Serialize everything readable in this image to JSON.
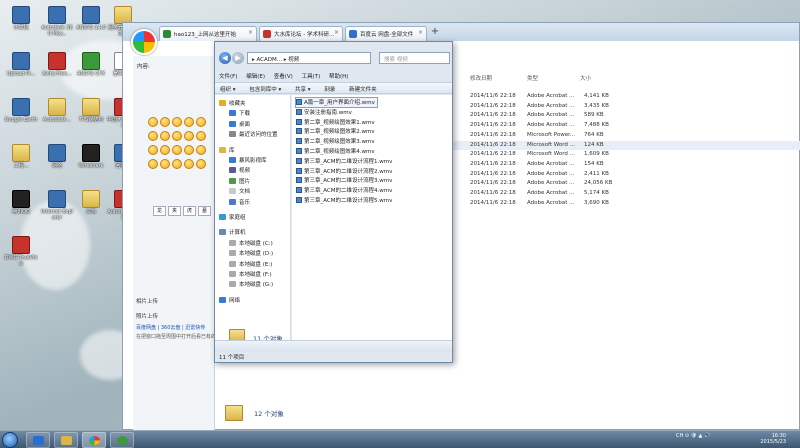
{
  "desktop": {
    "icons": [
      {
        "label": "计算机",
        "kind": "app"
      },
      {
        "label": "Autodesk 360 Max..",
        "kind": "app"
      },
      {
        "label": "ANSYS 14.0",
        "kind": "app"
      },
      {
        "label": "服务器版本开发...",
        "kind": "folder"
      },
      {
        "label": "Upload Pi...",
        "kind": "app"
      },
      {
        "label": "Avira Free...",
        "kind": "red"
      },
      {
        "label": "ANSYS CFX",
        "kind": "green"
      },
      {
        "label": "宽带连接",
        "kind": "doc"
      },
      {
        "label": "Google Earth",
        "kind": "app"
      },
      {
        "label": "Autodesk...",
        "kind": "folder"
      },
      {
        "label": "TPS钢结构",
        "kind": "folder"
      },
      {
        "label": "中国大学MOOC",
        "kind": "red"
      },
      {
        "label": "工程...",
        "kind": "folder"
      },
      {
        "label": "网络",
        "kind": "app"
      },
      {
        "label": "Wireshark",
        "kind": "black"
      },
      {
        "label": "回收站",
        "kind": "app"
      },
      {
        "label": "腾讯QQ",
        "kind": "black"
      },
      {
        "label": "Internet Explorer",
        "kind": "app"
      },
      {
        "label": "文档",
        "kind": "folder"
      },
      {
        "label": "Autodesk 360",
        "kind": "red"
      },
      {
        "label": "DWG TrueView",
        "kind": "red"
      }
    ]
  },
  "browser": {
    "tabs": [
      {
        "label": "hao123_上网从这里开始",
        "color": "#2a8a3a"
      },
      {
        "label": "大水库论坛 - 学术科研...",
        "color": "#c8322c"
      },
      {
        "label": "百度云 网盘-全部文件",
        "color": "#2e6fd0"
      }
    ],
    "new_tab": "+",
    "chat": {
      "content_label": "内容:",
      "buttons": [
        "龙",
        "夹",
        "虎",
        "墓"
      ],
      "footer_title": "相片上传",
      "footer_sub": "照片上传",
      "links": "百度网盘 | 360云盘 | 迅雷快传",
      "note": "在把窗口拖至周围中打开后看已有的"
    }
  },
  "background_list": {
    "headers": {
      "modified": "修改日期",
      "type": "类型",
      "size": "大小"
    },
    "rows": [
      {
        "date": "2014/11/6 22:18",
        "type": "Adobe Acrobat ...",
        "size": "4,141 KB"
      },
      {
        "date": "2014/11/6 22:18",
        "type": "Adobe Acrobat ...",
        "size": "3,435 KB"
      },
      {
        "date": "2014/11/6 22:18",
        "type": "Adobe Acrobat ...",
        "size": "589 KB"
      },
      {
        "date": "2014/11/6 22:18",
        "type": "Adobe Acrobat ...",
        "size": "7,488 KB"
      },
      {
        "date": "2014/11/6 22:18",
        "type": "Microsoft Power...",
        "size": "764 KB"
      },
      {
        "date": "2014/11/6 22:18",
        "type": "Microsoft Word ...",
        "size": "124 KB"
      },
      {
        "date": "2014/11/6 22:18",
        "type": "Microsoft Word ...",
        "size": "1,609 KB"
      },
      {
        "date": "2014/11/6 22:18",
        "type": "Adobe Acrobat ...",
        "size": "154 KB"
      },
      {
        "date": "2014/11/6 22:18",
        "type": "Adobe Acrobat ...",
        "size": "2,411 KB"
      },
      {
        "date": "2014/11/6 22:18",
        "type": "Adobe Acrobat ...",
        "size": "24,056 KB"
      },
      {
        "date": "2014/11/6 22:18",
        "type": "Adobe Acrobat ...",
        "size": "5,174 KB"
      },
      {
        "date": "2014/11/6 22:18",
        "type": "Adobe Acrobat ...",
        "size": "3,690 KB"
      }
    ],
    "count_label": "12 个对象"
  },
  "explorer": {
    "address": "▸ ACADM... ▸ 视频",
    "search_placeholder": "搜索 视频",
    "menu": [
      "文件(F)",
      "编辑(E)",
      "查看(V)",
      "工具(T)",
      "帮助(H)"
    ],
    "toolbar": [
      "组织 ▾",
      "包含到库中 ▾",
      "共享 ▾",
      "刻录",
      "新建文件夹"
    ],
    "nav": [
      {
        "label": "收藏夹",
        "level": "group",
        "color": "#e0b020"
      },
      {
        "label": "下载",
        "level": "child",
        "color": "#3a7bd0"
      },
      {
        "label": "桌面",
        "level": "child",
        "color": "#3a7bd0"
      },
      {
        "label": "最近访问的位置",
        "level": "child",
        "color": "#888"
      },
      {
        "label": "库",
        "level": "group",
        "color": "#d9b54a"
      },
      {
        "label": "暴风影视库",
        "level": "child",
        "color": "#3a7bd0"
      },
      {
        "label": "视频",
        "level": "child",
        "color": "#5a5a9a"
      },
      {
        "label": "图片",
        "level": "child",
        "color": "#4a9a4a"
      },
      {
        "label": "文档",
        "level": "child",
        "color": "#c9c9c9"
      },
      {
        "label": "音乐",
        "level": "child",
        "color": "#4a7ad0"
      },
      {
        "label": "家庭组",
        "level": "group",
        "color": "#3a9ad0"
      },
      {
        "label": "计算机",
        "level": "group",
        "color": "#6a8aa8"
      },
      {
        "label": "本地磁盘 (C:)",
        "level": "child",
        "color": "#aaa"
      },
      {
        "label": "本地磁盘 (D:)",
        "level": "child",
        "color": "#aaa"
      },
      {
        "label": "本地磁盘 (E:)",
        "level": "child",
        "color": "#aaa"
      },
      {
        "label": "本地磁盘 (F:)",
        "level": "child",
        "color": "#aaa"
      },
      {
        "label": "本地磁盘 (G:)",
        "level": "child",
        "color": "#aaa"
      },
      {
        "label": "网络",
        "level": "group",
        "color": "#3a7bd0"
      }
    ],
    "files": [
      "A篇一章_用户界面介绍.wmv",
      "安装注册指南.wmv",
      "第二章_视频绘图效果1.wmv",
      "第二章_视频绘图效果2.wmv",
      "第二章_视频绘图效果3.wmv",
      "第二章_视频绘图效果4.wmv",
      "第三章_ACM的二维设计流程1.wmv",
      "第三章_ACM的二维设计流程2.wmv",
      "第三章_ACM的二维设计流程3.wmv",
      "第三章_ACM的二维设计流程4.wmv",
      "第三章_ACM的二维设计流程5.wmv"
    ],
    "count_label": "11 个对象",
    "status_bottom": "11 个项目"
  },
  "taskbar": {
    "tray_text": "CH ⊙ 🛡 ▲ 🔊",
    "time": "16:30",
    "date": "2015/5/23"
  }
}
